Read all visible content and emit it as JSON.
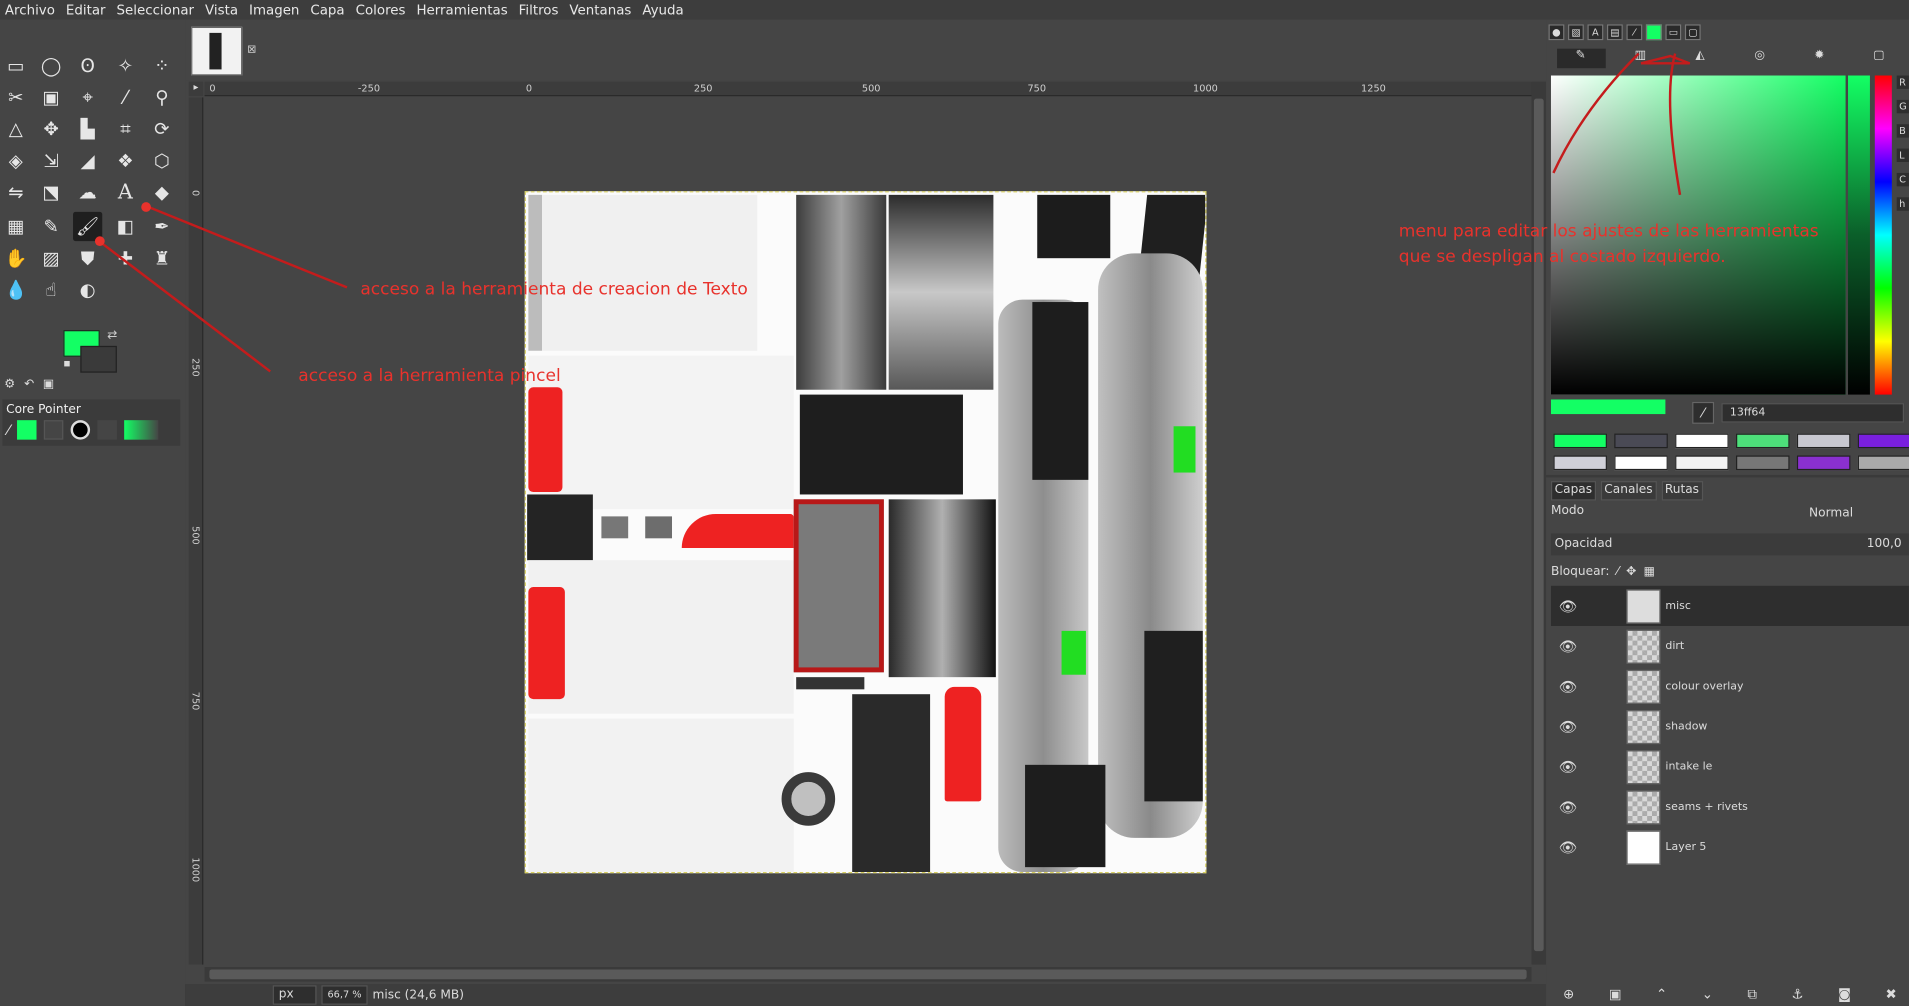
{
  "menu": [
    "Archivo",
    "Editar",
    "Seleccionar",
    "Vista",
    "Imagen",
    "Capa",
    "Colores",
    "Herramientas",
    "Filtros",
    "Ventanas",
    "Ayuda"
  ],
  "tool_options_title": "Core Pointer",
  "ruler_h": [
    "0",
    "-250",
    "0",
    "250",
    "500",
    "750",
    "1000",
    "1250"
  ],
  "ruler_v": [
    "0",
    "250",
    "500",
    "750",
    "1000"
  ],
  "color": {
    "hex": "13ff64",
    "channel_labels": [
      "R",
      "G",
      "B",
      "L",
      "C",
      "h"
    ],
    "fg": "#13ff64"
  },
  "layers_panel": {
    "tabs": [
      "Capas",
      "Canales",
      "Rutas"
    ],
    "mode_label": "Modo",
    "mode_value": "Normal",
    "opacity_label": "Opacidad",
    "opacity_value": "100,0",
    "lock_label": "Bloquear:",
    "layers": [
      "misc",
      "dirt",
      "colour overlay",
      "shadow",
      "intake le",
      "seams + rivets",
      "Layer 5"
    ]
  },
  "status": {
    "unit": "px",
    "zoom": "66,7 %",
    "info": "misc (24,6 MB)"
  },
  "annotations": {
    "text_tool": "acceso a la herramienta de creacion de Texto",
    "brush_tool": "acceso a la herramienta pincel",
    "tool_options": "menu para editar los ajustes de las herramientas que se despligan al costado izquierdo."
  }
}
